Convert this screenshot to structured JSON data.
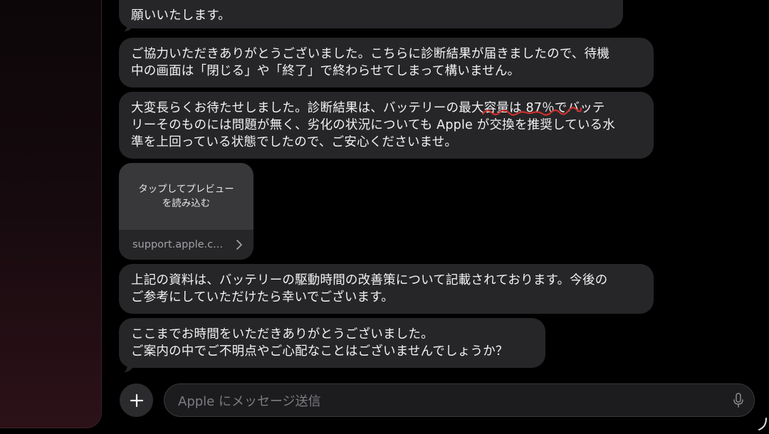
{
  "messages": [
    {
      "lines": [
        "願いいたします。"
      ]
    },
    {
      "lines": [
        "ご協力いただきありがとうございました。こちらに診断結果が届きましたので、待機",
        "中の画面は「閉じる」や「終了」で終わらせてしまって構いません。"
      ]
    },
    {
      "lines": [
        "大変長らくお待たせしました。診断結果は、バッテリーの最大容量は 87％でバッテ",
        "リーそのものには問題が無く、劣化の状況についても Apple が交換を推奨している水",
        "準を上回っている状態でしたので、ご安心くださいませ。"
      ]
    },
    {
      "lines": [
        "上記の資料は、バッテリーの駆動時間の改善策について記載されております。今後の",
        "ご参考にしていただけたら幸いでございます。"
      ]
    },
    {
      "lines": [
        "ここまでお時間をいただきありがとうございました。",
        "ご案内の中でご不明点やご心配なことはございませんでしょうか？"
      ]
    }
  ],
  "link_preview": {
    "placeholder_lines": [
      "タップしてプレビュー",
      "を読み込む"
    ],
    "url": "support.apple.c..."
  },
  "composer": {
    "placeholder": "Apple にメッセージ送信"
  },
  "colors": {
    "background": "#000000",
    "bubble": "#262628",
    "text": "#f2f2f4",
    "spellcheck_underline": "#d0302c"
  },
  "icons": {
    "add": "plus-icon",
    "preview_open": "chevron-right-icon",
    "dictation": "microphone-icon"
  }
}
